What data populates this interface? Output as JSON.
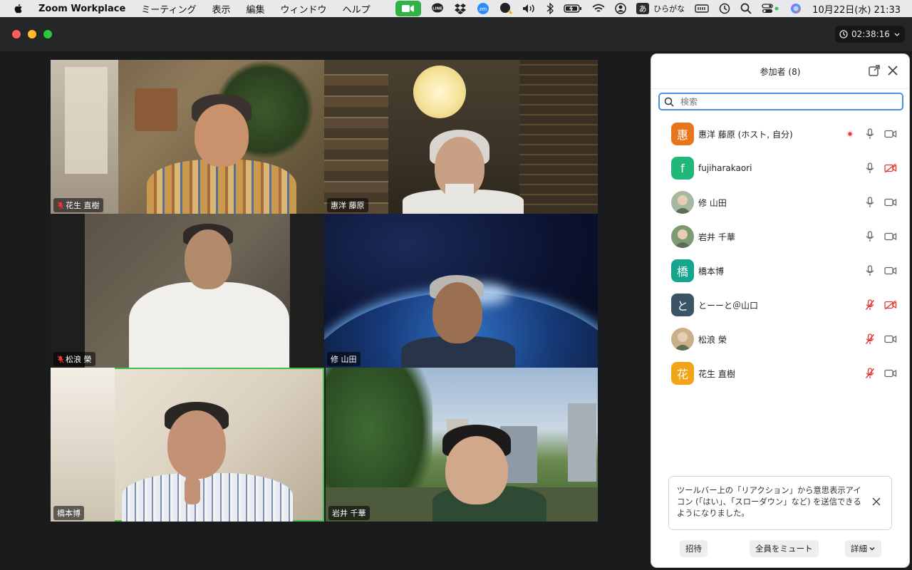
{
  "menubar": {
    "app_name": "Zoom Workplace",
    "menus": [
      "ミーティング",
      "表示",
      "編集",
      "ウィンドウ",
      "ヘルプ"
    ],
    "ime_glyph": "あ",
    "ime_label": "ひらがな",
    "clock": "10月22日(水)  21:33"
  },
  "window": {
    "timer": "02:38:16"
  },
  "videos": [
    {
      "name": "花生 直樹",
      "muted": true
    },
    {
      "name": "惠洋 藤原",
      "muted": false
    },
    {
      "name": "松浪 榮",
      "muted": true
    },
    {
      "name": "修 山田",
      "muted": false
    },
    {
      "name": "橋本博",
      "muted": false,
      "active": true
    },
    {
      "name": "岩井 千華",
      "muted": false
    }
  ],
  "panel": {
    "title": "参加者 (8)",
    "search_placeholder": "検索",
    "participants": [
      {
        "initial": "惠",
        "name": "惠洋 藤原 (ホスト, 自分)",
        "color": "#e8741c",
        "mic": "on",
        "cam": "on",
        "recording": true
      },
      {
        "initial": "f",
        "name": "fujiharakaori",
        "color": "#1fb879",
        "mic": "on",
        "cam": "off"
      },
      {
        "initial": "",
        "name": "修 山田",
        "color": "#a7b8a0",
        "mic": "on",
        "cam": "on"
      },
      {
        "initial": "",
        "name": "岩井 千華",
        "color": "#7c9a74",
        "mic": "on",
        "cam": "on"
      },
      {
        "initial": "橋",
        "name": "橋本博",
        "color": "#14a58c",
        "mic": "on",
        "cam": "on"
      },
      {
        "initial": "と",
        "name": "とーーと＠山口",
        "color": "#3b5567",
        "mic": "off",
        "cam": "off"
      },
      {
        "initial": "",
        "name": "松浪 榮",
        "color": "#c9b08a",
        "mic": "off",
        "cam": "on"
      },
      {
        "initial": "花",
        "name": "花生 直樹",
        "color": "#f2a317",
        "mic": "off",
        "cam": "on"
      }
    ],
    "notice": "ツールバー上の「リアクション」から意思表示アイコン (「はい」、「スローダウン」など) を送信できるようになりました。",
    "buttons": {
      "invite": "招待",
      "mute_all": "全員をミュート",
      "more": "詳細"
    }
  }
}
